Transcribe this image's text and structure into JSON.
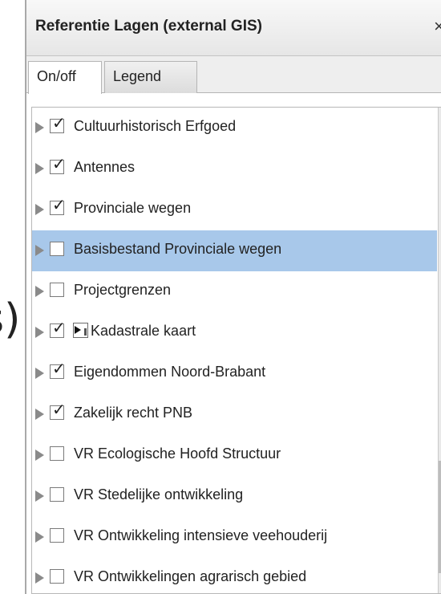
{
  "window": {
    "title": "Referentie Lagen (external GIS)",
    "close_glyph": "×"
  },
  "tabs": [
    {
      "label": "On/off",
      "active": true
    },
    {
      "label": "Legend",
      "active": false
    }
  ],
  "background_glyph": "s)",
  "layers": [
    {
      "label": "Cultuurhistorisch Erfgoed",
      "checked": true,
      "selected": false
    },
    {
      "label": "Antennes",
      "checked": true,
      "selected": false
    },
    {
      "label": "Provinciale wegen",
      "checked": true,
      "selected": false
    },
    {
      "label": "Basisbestand Provinciale wegen",
      "checked": false,
      "selected": true
    },
    {
      "label": "Projectgrenzen",
      "checked": false,
      "selected": false
    },
    {
      "label": "Kadastrale kaart",
      "checked": true,
      "selected": false,
      "icon": "layer-options-icon"
    },
    {
      "label": "Eigendommen Noord-Brabant",
      "checked": true,
      "selected": false
    },
    {
      "label": "Zakelijk recht PNB",
      "checked": true,
      "selected": false
    },
    {
      "label": "VR Ecologische Hoofd Structuur",
      "checked": false,
      "selected": false
    },
    {
      "label": "VR Stedelijke ontwikkeling",
      "checked": false,
      "selected": false
    },
    {
      "label": "VR Ontwikkeling intensieve veehouderij",
      "checked": false,
      "selected": false
    },
    {
      "label": "VR Ontwikkelingen agrarisch gebied",
      "checked": false,
      "selected": false
    }
  ],
  "colors": {
    "selected_row": "#a8c8ea",
    "titlebar": "#eeeeee"
  }
}
